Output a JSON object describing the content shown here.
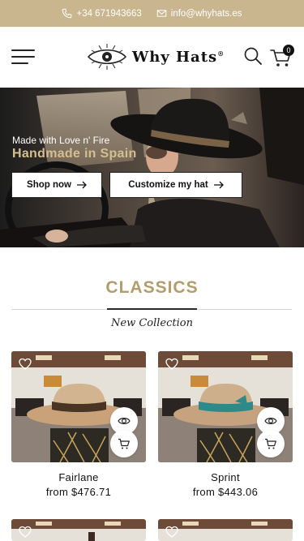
{
  "topbar": {
    "phone": "+34 671943663",
    "email": "info@whyhats.es",
    "bg_color": "#c9b68f"
  },
  "header": {
    "brand": "Why Hats",
    "trademark": "®",
    "cart_count": "0",
    "icons": [
      "menu-icon",
      "search-icon",
      "cart-icon"
    ]
  },
  "hero": {
    "tagline": "Made with Love n' Fire",
    "headline": "Handmade in Spain",
    "shop_now": "Shop now",
    "customize": "Customize my hat",
    "accent_color": "#d4bf8f"
  },
  "collection": {
    "title": "CLASSICS",
    "subtitle": "New Collection",
    "title_color": "#b29d6d"
  },
  "products": [
    {
      "name": "Fairlane",
      "price": "from $476.71",
      "band": "#4a3424"
    },
    {
      "name": "Sprint",
      "price": "from $443.06",
      "band": "#2e8a8a"
    }
  ]
}
